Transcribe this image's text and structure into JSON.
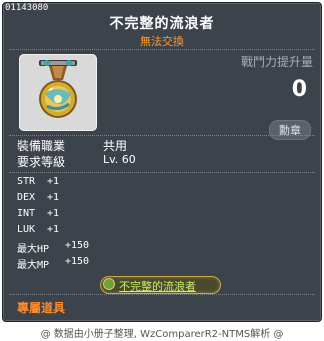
{
  "header": {
    "item_id": "01143080",
    "item_name": "不完整的流浪者",
    "trade_status": "無法交換"
  },
  "power": {
    "label": "戰鬥力提升量",
    "value": "0",
    "medal_button": "勳章"
  },
  "requirements": {
    "job_label": "裝備職業",
    "job_value": "共用",
    "level_label": "要求等級",
    "level_value": "Lv. 60"
  },
  "stats": [
    {
      "name": "STR",
      "value": "+1"
    },
    {
      "name": "DEX",
      "value": "+1"
    },
    {
      "name": "INT",
      "value": "+1"
    },
    {
      "name": "LUK",
      "value": "+1"
    },
    {
      "name": "最大HP",
      "value": "+150"
    },
    {
      "name": "最大MP",
      "value": "+150"
    }
  ],
  "set_item": {
    "label": "不完整的流浪者",
    "icon": "set-emblem-icon"
  },
  "exclusive_label": "專屬道具",
  "footer": "@ 数据由小册子整理, WzComparerR2-NTMS解析 @",
  "colors": {
    "background": "#3c434b",
    "item_name": "#ffffff",
    "trade_status": "#ff9a2e",
    "exclusive": "#ff8a2a",
    "set_label": "#c8ef6a"
  },
  "icon": "medal-icon"
}
